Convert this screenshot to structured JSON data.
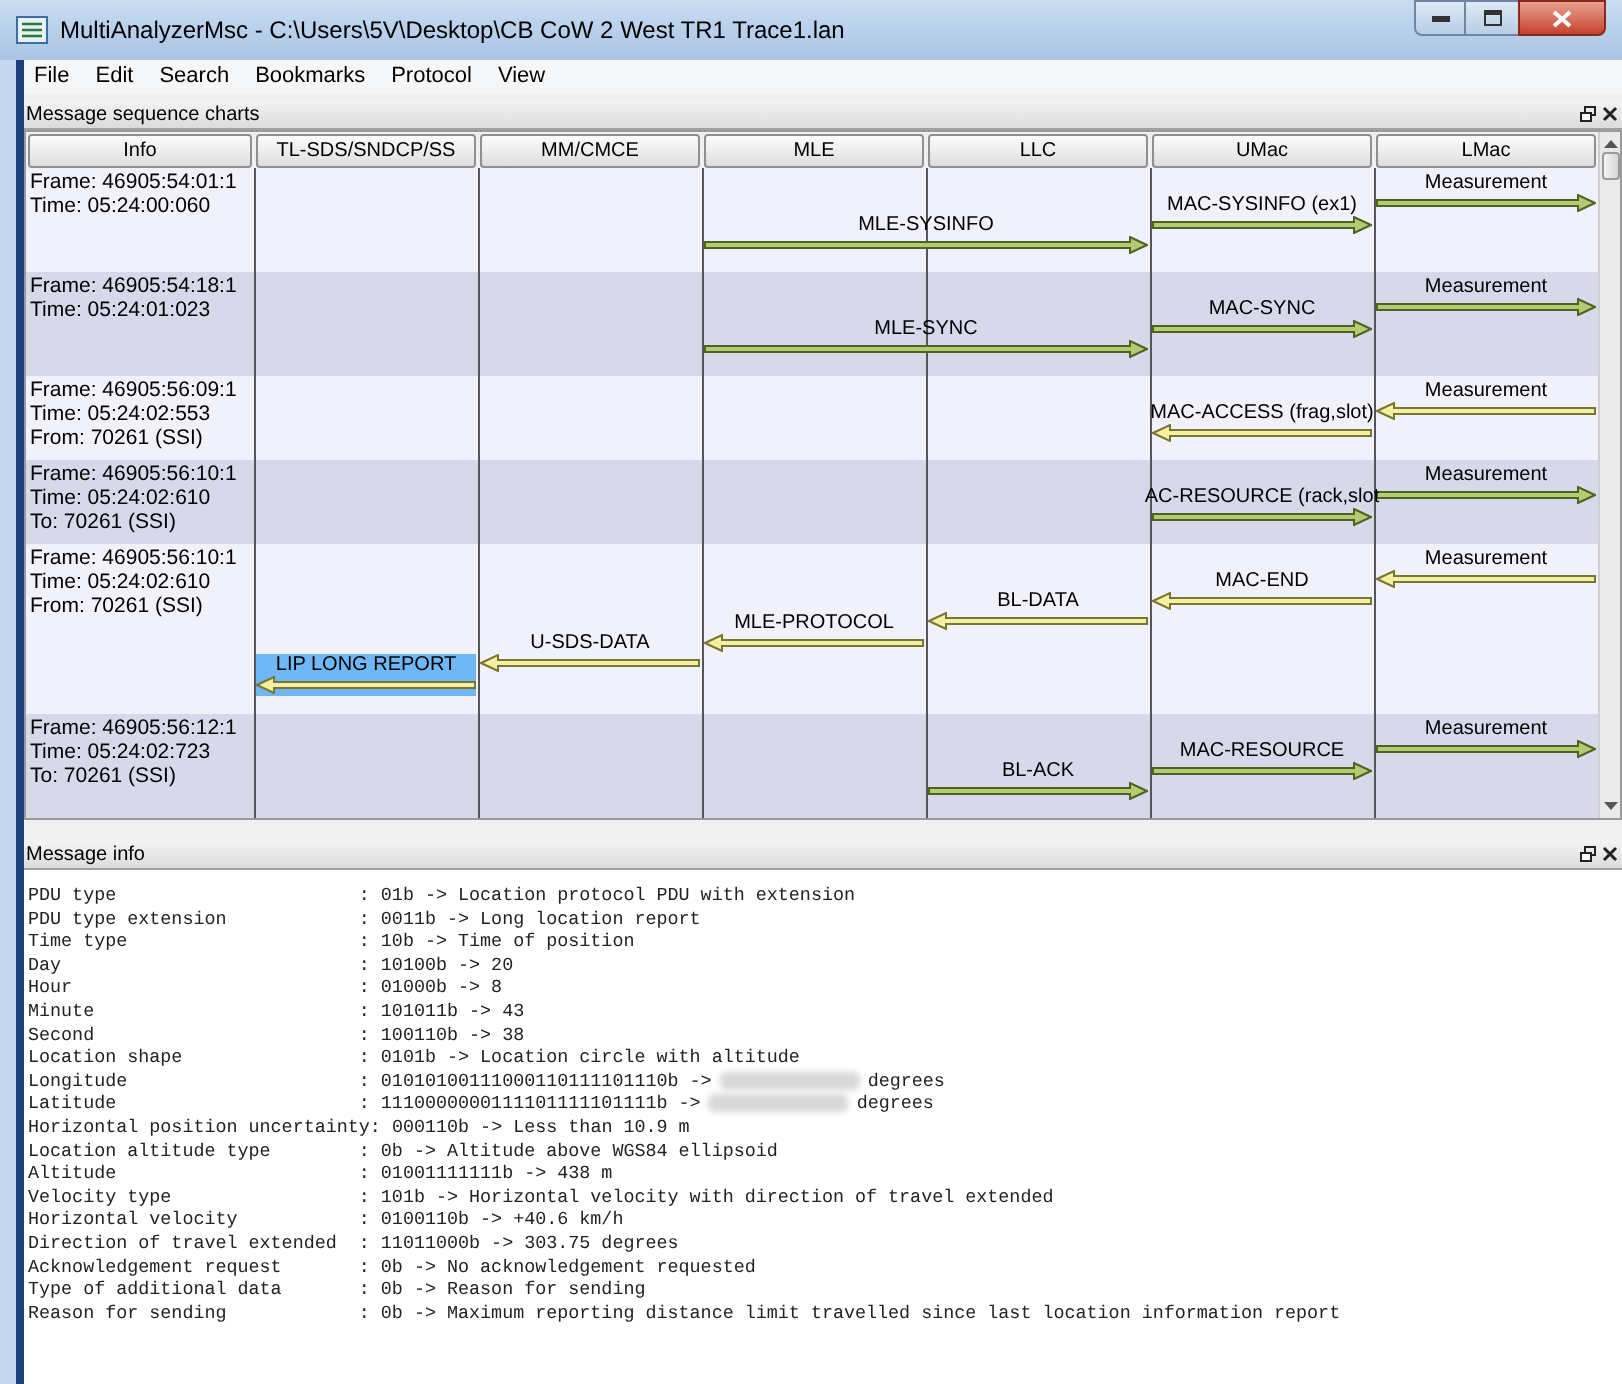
{
  "window": {
    "title": "MultiAnalyzerMsc - C:\\Users\\5V\\Desktop\\CB CoW 2 West TR1 Trace1.lan"
  },
  "menu": [
    "File",
    "Edit",
    "Search",
    "Bookmarks",
    "Protocol",
    "View"
  ],
  "chart_panel": {
    "title": "Message sequence charts",
    "columns": [
      "Info",
      "TL-SDS/SNDCP/SS",
      "MM/CMCE",
      "MLE",
      "LLC",
      "UMac",
      "LMac"
    ],
    "rows": [
      {
        "info": [
          "Frame: 46905:54:01:1",
          "Time: 05:24:00:060"
        ],
        "lanes": [
          {
            "arrow": false
          },
          {
            "arrow": false
          },
          {
            "arrow": true,
            "label": "MLE-SYSINFO",
            "rightward": true,
            "wide": true,
            "selected": false
          },
          {
            "arrow": false
          },
          {
            "arrow": true,
            "label": "MAC-SYSINFO (ex1)",
            "rightward": true,
            "wide": false,
            "selected": false
          },
          {
            "arrow": true,
            "label": "Measurement",
            "rightward": true,
            "wide": false,
            "selected": false
          }
        ]
      },
      {
        "info": [
          "Frame: 46905:54:18:1",
          "Time: 05:24:01:023"
        ],
        "lanes": [
          {
            "arrow": false
          },
          {
            "arrow": false
          },
          {
            "arrow": true,
            "label": "MLE-SYNC",
            "rightward": true,
            "wide": true,
            "selected": false
          },
          {
            "arrow": false
          },
          {
            "arrow": true,
            "label": "MAC-SYNC",
            "rightward": true,
            "wide": false,
            "selected": false
          },
          {
            "arrow": true,
            "label": "Measurement",
            "rightward": true,
            "wide": false,
            "selected": false
          }
        ]
      },
      {
        "info": [
          "Frame: 46905:56:09:1",
          "Time: 05:24:02:553",
          "From: 70261 (SSI)"
        ],
        "lanes": [
          {
            "arrow": false
          },
          {
            "arrow": false
          },
          {
            "arrow": false
          },
          {
            "arrow": false
          },
          {
            "arrow": true,
            "label": "MAC-ACCESS (frag,slot)",
            "rightward": false,
            "wide": false,
            "selected": false
          },
          {
            "arrow": true,
            "label": "Measurement",
            "rightward": false,
            "wide": false,
            "selected": false
          }
        ]
      },
      {
        "info": [
          "Frame: 46905:56:10:1",
          "Time: 05:24:02:610",
          "To: 70261 (SSI)"
        ],
        "lanes": [
          {
            "arrow": false
          },
          {
            "arrow": false
          },
          {
            "arrow": false
          },
          {
            "arrow": false
          },
          {
            "arrow": true,
            "label": "AC-RESOURCE (rack,slot",
            "rightward": true,
            "wide": false,
            "selected": false
          },
          {
            "arrow": true,
            "label": "Measurement",
            "rightward": true,
            "wide": false,
            "selected": false
          }
        ]
      },
      {
        "info": [
          "Frame: 46905:56:10:1",
          "Time: 05:24:02:610",
          "From: 70261 (SSI)"
        ],
        "lanes": [
          {
            "arrow": true,
            "label": "LIP LONG REPORT",
            "rightward": false,
            "wide": false,
            "selected": true
          },
          {
            "arrow": true,
            "label": "U-SDS-DATA",
            "rightward": false,
            "wide": false,
            "selected": false
          },
          {
            "arrow": true,
            "label": "MLE-PROTOCOL",
            "rightward": false,
            "wide": false,
            "selected": false
          },
          {
            "arrow": true,
            "label": "BL-DATA",
            "rightward": false,
            "wide": false,
            "selected": false
          },
          {
            "arrow": true,
            "label": "MAC-END",
            "rightward": false,
            "wide": false,
            "selected": false
          },
          {
            "arrow": true,
            "label": "Measurement",
            "rightward": false,
            "wide": false,
            "selected": false
          }
        ]
      },
      {
        "info": [
          "Frame: 46905:56:12:1",
          "Time: 05:24:02:723",
          "To: 70261 (SSI)"
        ],
        "lanes": [
          {
            "arrow": false
          },
          {
            "arrow": false
          },
          {
            "arrow": false
          },
          {
            "arrow": true,
            "label": "BL-ACK",
            "rightward": true,
            "wide": false,
            "selected": false
          },
          {
            "arrow": true,
            "label": "MAC-RESOURCE",
            "rightward": true,
            "wide": false,
            "selected": false
          },
          {
            "arrow": true,
            "label": "Measurement",
            "rightward": true,
            "wide": false,
            "selected": false
          }
        ]
      }
    ]
  },
  "info_panel": {
    "title": "Message info",
    "lines": [
      {
        "field": "PDU type",
        "value": ": 01b -> Location protocol PDU with extension"
      },
      {
        "field": "PDU type extension",
        "value": ": 0011b -> Long location report"
      },
      {
        "field": "Time type",
        "value": ": 10b -> Time of position"
      },
      {
        "field": "Day",
        "value": ": 10100b -> 20"
      },
      {
        "field": "Hour",
        "value": ": 01000b -> 8"
      },
      {
        "field": "Minute",
        "value": ": 101011b -> 43"
      },
      {
        "field": "Second",
        "value": ": 100110b -> 38"
      },
      {
        "field": "Location shape",
        "value": ": 0101b -> Location circle with altitude"
      },
      {
        "field": "Longitude",
        "value": ": 01010100111000110111101110b ->",
        "redacted": true,
        "unit": "degrees"
      },
      {
        "field": "Latitude",
        "value": ": 1110000000111101111101111b ->",
        "redacted": true,
        "unit": "degrees"
      },
      {
        "field": "Horizontal position uncertainty",
        "value": ": 000110b -> Less than 10.9 m"
      },
      {
        "field": "Location altitude type",
        "value": ": 0b -> Altitude above WGS84 ellipsoid"
      },
      {
        "field": "Altitude",
        "value": ": 01001111111b -> 438 m"
      },
      {
        "field": "Velocity type",
        "value": ": 101b -> Horizontal velocity with direction of travel extended"
      },
      {
        "field": "Horizontal velocity",
        "value": ": 0100110b -> +40.6 km/h"
      },
      {
        "field": "Direction of travel extended",
        "value": ": 11011000b -> 303.75 degrees"
      },
      {
        "field": "Acknowledgement request",
        "value": ": 0b -> No acknowledgement requested"
      },
      {
        "field": "Type of additional data",
        "value": ": 0b -> Reason for sending"
      },
      {
        "field": "Reason for sending",
        "value": ": 0b -> Maximum reporting distance limit travelled since last location information report"
      }
    ]
  }
}
